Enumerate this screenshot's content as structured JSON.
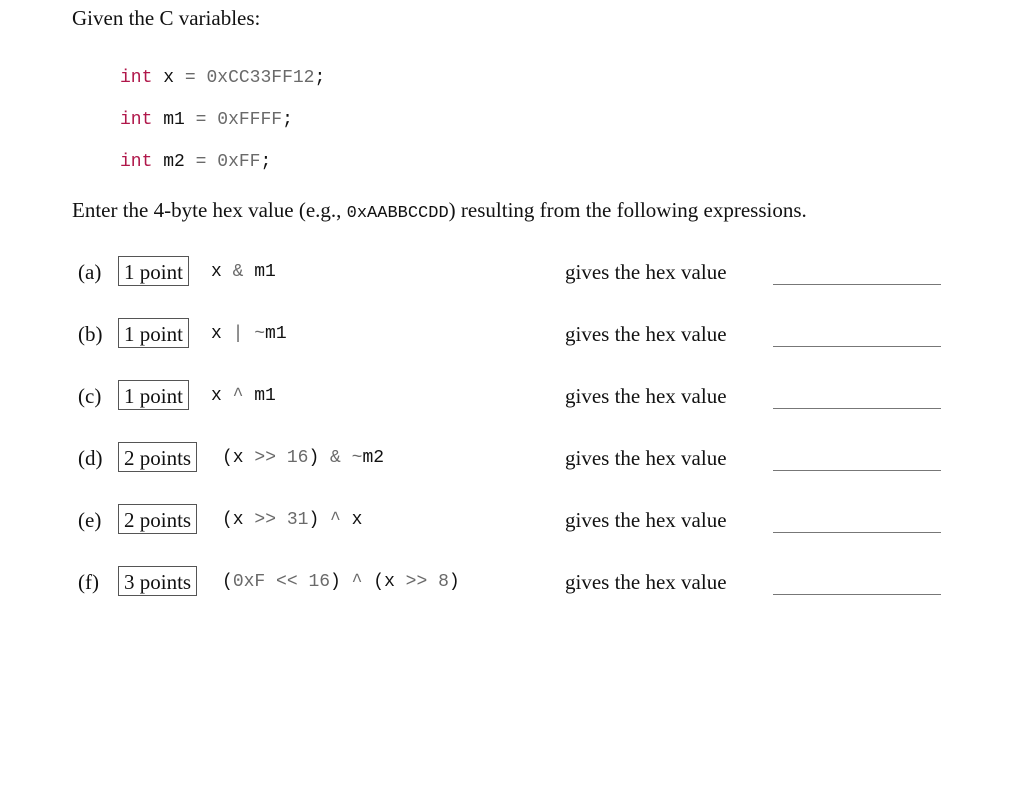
{
  "intro": "Given the C variables:",
  "declarations": [
    {
      "type": "int",
      "name": "x",
      "eq": "=",
      "value": "0xCC33FF12",
      "semi": ";"
    },
    {
      "type": "int",
      "name": "m1",
      "eq": "=",
      "value": "0xFFFF",
      "semi": ";"
    },
    {
      "type": "int",
      "name": "m2",
      "eq": "=",
      "value": "0xFF",
      "semi": ";"
    }
  ],
  "instructions": {
    "before": "Enter the 4-byte hex value (e.g., ",
    "example": "0xAABBCCDD",
    "after": ") resulting from the following expressions."
  },
  "questions": [
    {
      "label": "(a)",
      "points": "1 point",
      "expr": [
        [
          "id",
          "x"
        ],
        [
          "op",
          " & "
        ],
        [
          "id",
          "m1"
        ]
      ],
      "gives": "gives the hex value",
      "answer": ""
    },
    {
      "label": "(b)",
      "points": "1 point",
      "expr": [
        [
          "id",
          "x"
        ],
        [
          "op",
          " | "
        ],
        [
          "op",
          "~"
        ],
        [
          "id",
          "m1"
        ]
      ],
      "gives": "gives the hex value",
      "answer": ""
    },
    {
      "label": "(c)",
      "points": "1 point",
      "expr": [
        [
          "id",
          "x"
        ],
        [
          "op",
          " ^ "
        ],
        [
          "id",
          "m1"
        ]
      ],
      "gives": "gives the hex value",
      "answer": ""
    },
    {
      "label": "(d)",
      "points": "2 points",
      "expr": [
        [
          "id",
          "(x"
        ],
        [
          "op",
          " >> "
        ],
        [
          "num",
          "16"
        ],
        [
          "id",
          ")"
        ],
        [
          "op",
          " & "
        ],
        [
          "op",
          "~"
        ],
        [
          "id",
          "m2"
        ]
      ],
      "gives": "gives the hex value",
      "answer": ""
    },
    {
      "label": "(e)",
      "points": "2 points",
      "expr": [
        [
          "id",
          "(x"
        ],
        [
          "op",
          " >> "
        ],
        [
          "num",
          "31"
        ],
        [
          "id",
          ")"
        ],
        [
          "op",
          " ^ "
        ],
        [
          "id",
          "x"
        ]
      ],
      "gives": "gives the hex value",
      "answer": ""
    },
    {
      "label": "(f)",
      "points": "3 points",
      "expr": [
        [
          "id",
          "("
        ],
        [
          "num",
          "0xF"
        ],
        [
          "op",
          " << "
        ],
        [
          "num",
          "16"
        ],
        [
          "id",
          ")"
        ],
        [
          "op",
          " ^ "
        ],
        [
          "id",
          "(x"
        ],
        [
          "op",
          " >> "
        ],
        [
          "num",
          "8"
        ],
        [
          "id",
          ")"
        ]
      ],
      "gives": "gives the hex value",
      "answer": ""
    }
  ]
}
